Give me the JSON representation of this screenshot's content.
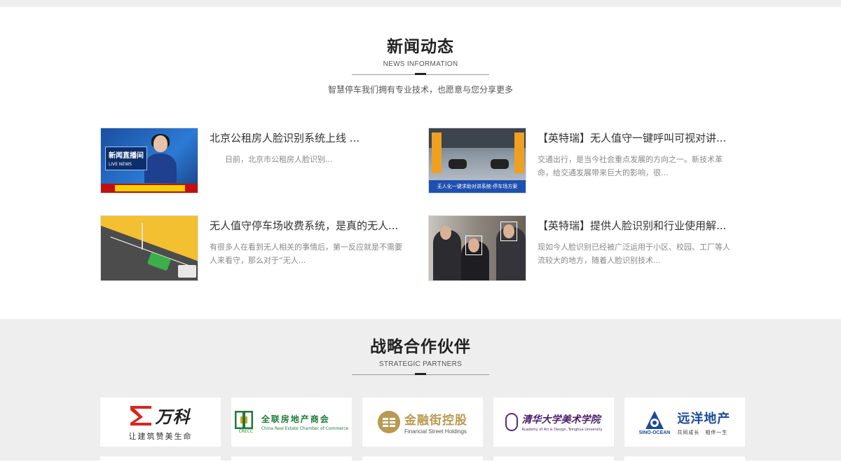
{
  "news_section": {
    "title": "新闻动态",
    "subtitle": "NEWS INFORMATION",
    "description": "智慧停车我们拥有专业技术，也愿意与您分享更多",
    "items": [
      {
        "title": "北京公租房人脸识别系统上线 ...",
        "summary": "　　日前，北京市公租房人脸识别...",
        "thumb_caption": "新闻直播间",
        "thumb_caption2": "LIVE NEWS"
      },
      {
        "title": "【英特瑞】无人值守一键呼叫可视对讲...",
        "summary": "交通出行，是当今社会重点发展的方向之一。新技术革命，给交通发展带来巨大的影响，很...",
        "thumb_caption": "无人化一键求助对讲系统-停车场方案"
      },
      {
        "title": "无人值守停车场收费系统，是真的无人...",
        "summary": "有很多人在看到无人相关的事情后，第一反应就是不需要人来看守，那么对于“无人..."
      },
      {
        "title": "【英特瑞】提供人脸识别和行业使用解...",
        "summary": "现如今人脸识别已经被广泛运用于小区、校园、工厂等人流较大的地方，随着人脸识别技术..."
      }
    ]
  },
  "partners_section": {
    "title": "战略合作伙伴",
    "subtitle": "STRATEGIC PARTNERS",
    "partners": [
      {
        "name": "万科",
        "slogan": "让建筑赞美生命",
        "color": "#d7261e"
      },
      {
        "name": "全联房地产商会",
        "en": "China Real Estate Chamber of Commerce",
        "abbr": "CRECC",
        "color": "#1f7a3a"
      },
      {
        "name": "金融街控股",
        "en": "Financial Street Holdings",
        "color": "#b99a52"
      },
      {
        "name": "清华大学美术学院",
        "en": "Academy of Art & Design, Tsinghua University",
        "color": "#4a1f6a"
      },
      {
        "name": "远洋地产",
        "en": "SINO-OCEAN",
        "slogan": "共同成长　相伴一生",
        "color": "#1b4a9a"
      }
    ]
  }
}
